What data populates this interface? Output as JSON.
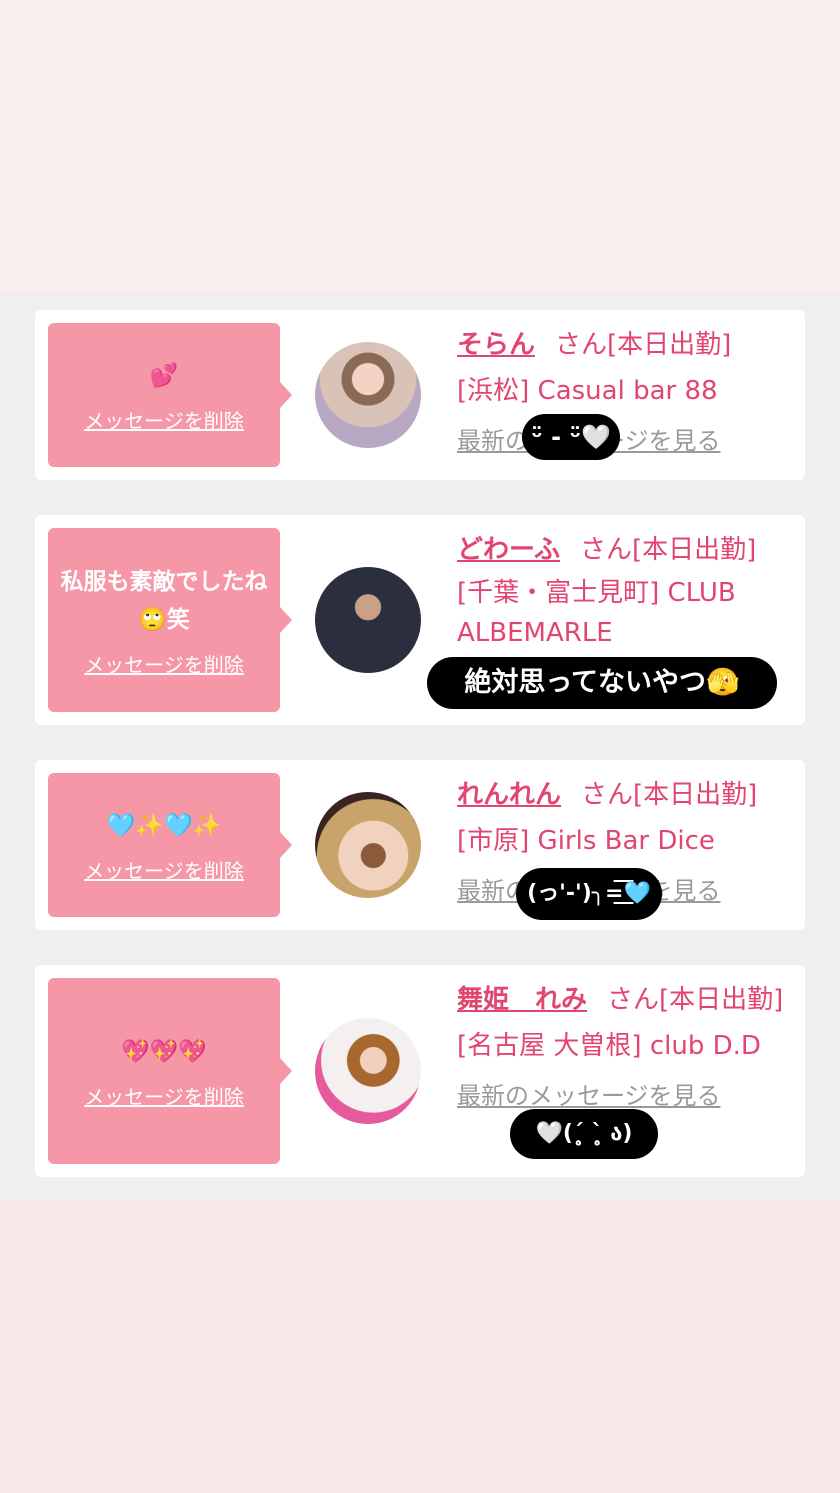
{
  "delete_label": "メッセージを削除",
  "latest_label": "最新のメッセージを見る",
  "colors": {
    "accent": "#e2456f",
    "bubble": "#f597a6"
  },
  "cards": [
    {
      "message": "💕",
      "name": "そらん",
      "status": "さん[本日出勤]",
      "shop": "[浜松] Casual bar 88",
      "sticker": "ᵕ̈ - ᵕ̈🤍"
    },
    {
      "message": "私服も素敵でしたね🙄笑",
      "name": "どわーふ",
      "status": "さん[本日出勤]",
      "shop": "[千葉・富士見町] CLUB ALBEMARLE",
      "sticker": "絶対思ってないやつ🫣"
    },
    {
      "message": "🩵✨🩵✨",
      "name": "れんれん",
      "status": "さん[本日出勤]",
      "shop": "[市原] Girls Bar Dice",
      "sticker": "(っ'-')╮=͟͟͞͞🩵"
    },
    {
      "message": "💖💖💖",
      "name": "舞姫　れみ",
      "status": "さん[本日出勤]",
      "shop": "[名古屋 大曽根] club D.D",
      "sticker": "🤍(ˊ̥̥̥̥̥ ˋ̥̥̥̥̥ ა)"
    }
  ]
}
